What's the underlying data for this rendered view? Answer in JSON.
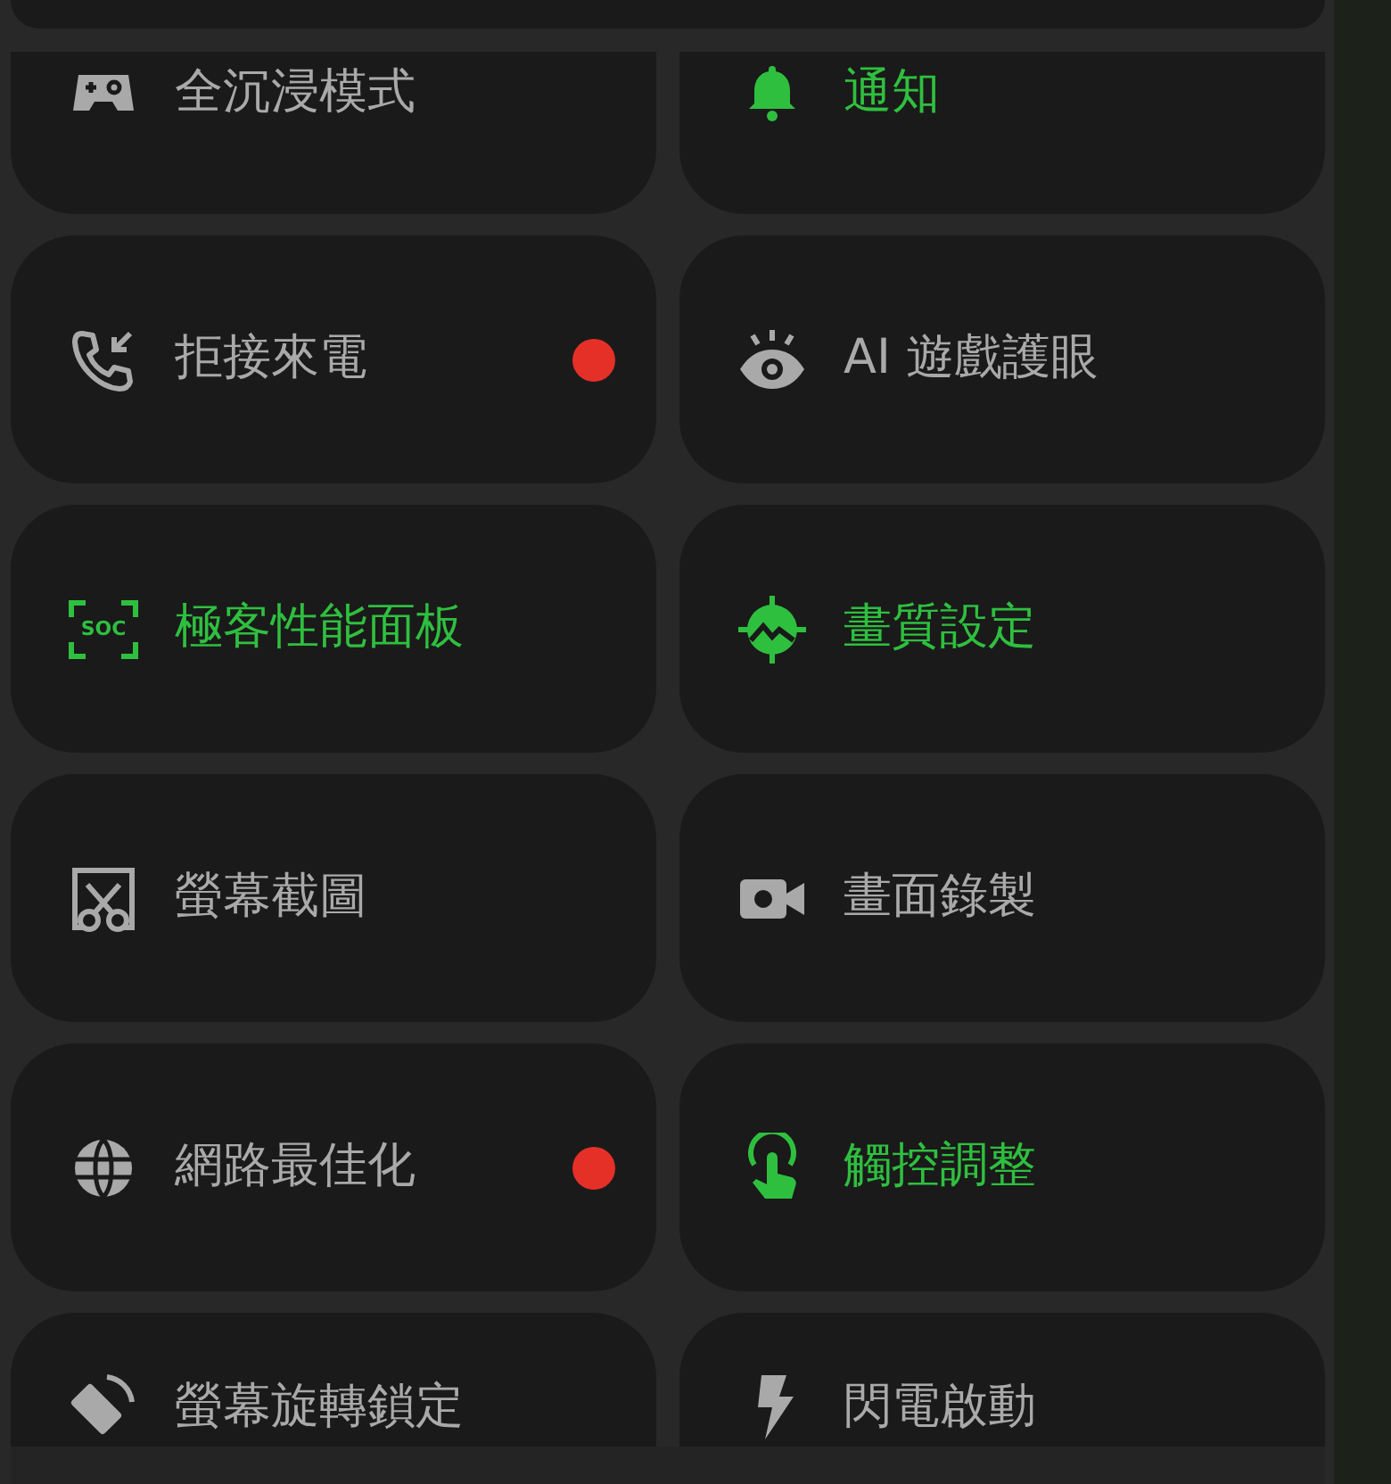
{
  "tiles": [
    {
      "label": "全沉浸模式",
      "active": false,
      "badge": false
    },
    {
      "label": "通知",
      "active": true,
      "badge": false
    },
    {
      "label": "拒接來電",
      "active": false,
      "badge": true
    },
    {
      "label": "AI 遊戲護眼",
      "active": false,
      "badge": false
    },
    {
      "label": "極客性能面板",
      "active": true,
      "badge": false,
      "icon_text": "SOC"
    },
    {
      "label": "畫質設定",
      "active": true,
      "badge": false
    },
    {
      "label": "螢幕截圖",
      "active": false,
      "badge": false
    },
    {
      "label": "畫面錄製",
      "active": false,
      "badge": false
    },
    {
      "label": "網路最佳化",
      "active": false,
      "badge": true
    },
    {
      "label": "觸控調整",
      "active": true,
      "badge": false
    },
    {
      "label": "螢幕旋轉鎖定",
      "active": false,
      "badge": false
    },
    {
      "label": "閃電啟動",
      "active": false,
      "badge": false
    }
  ]
}
